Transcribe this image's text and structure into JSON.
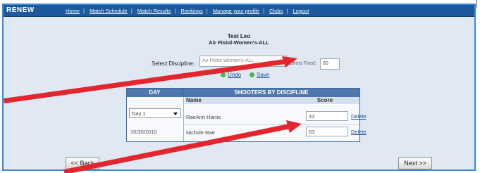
{
  "app": {
    "logo": "RENEW"
  },
  "nav": [
    "Home",
    "Match Schedule",
    "Match Results",
    "Rankings",
    "Manage your profile",
    "Clubs",
    "Logout"
  ],
  "page": {
    "user": "Test Leo",
    "discipline_title": "Air Pistol-Women's-ALL"
  },
  "form": {
    "discipline_label": "Select Discipline:",
    "discipline_value": "Air Pistol-Women's-ALL",
    "shots_label": "Shots Fired:",
    "shots_value": "60",
    "undo": "Undo",
    "save": "Save"
  },
  "table": {
    "day_header": "DAY",
    "shooters_header": "SHOOTERS BY DISCIPLINE",
    "name_col": "Name",
    "score_col": "Score",
    "day_value": "Day 1",
    "date": "10/30/2010",
    "delete_label": "Delete",
    "rows": [
      {
        "name": "RaeAnn Harris",
        "score": "43"
      },
      {
        "name": "Nichole Rae",
        "score": "53"
      }
    ]
  },
  "buttons": {
    "back": "<< Back",
    "next": "Next >>"
  },
  "colors": {
    "header_bg": "#1c5a9d",
    "panel_bg": "#dfe8f3",
    "annotation_arrow": "#e3262e"
  }
}
